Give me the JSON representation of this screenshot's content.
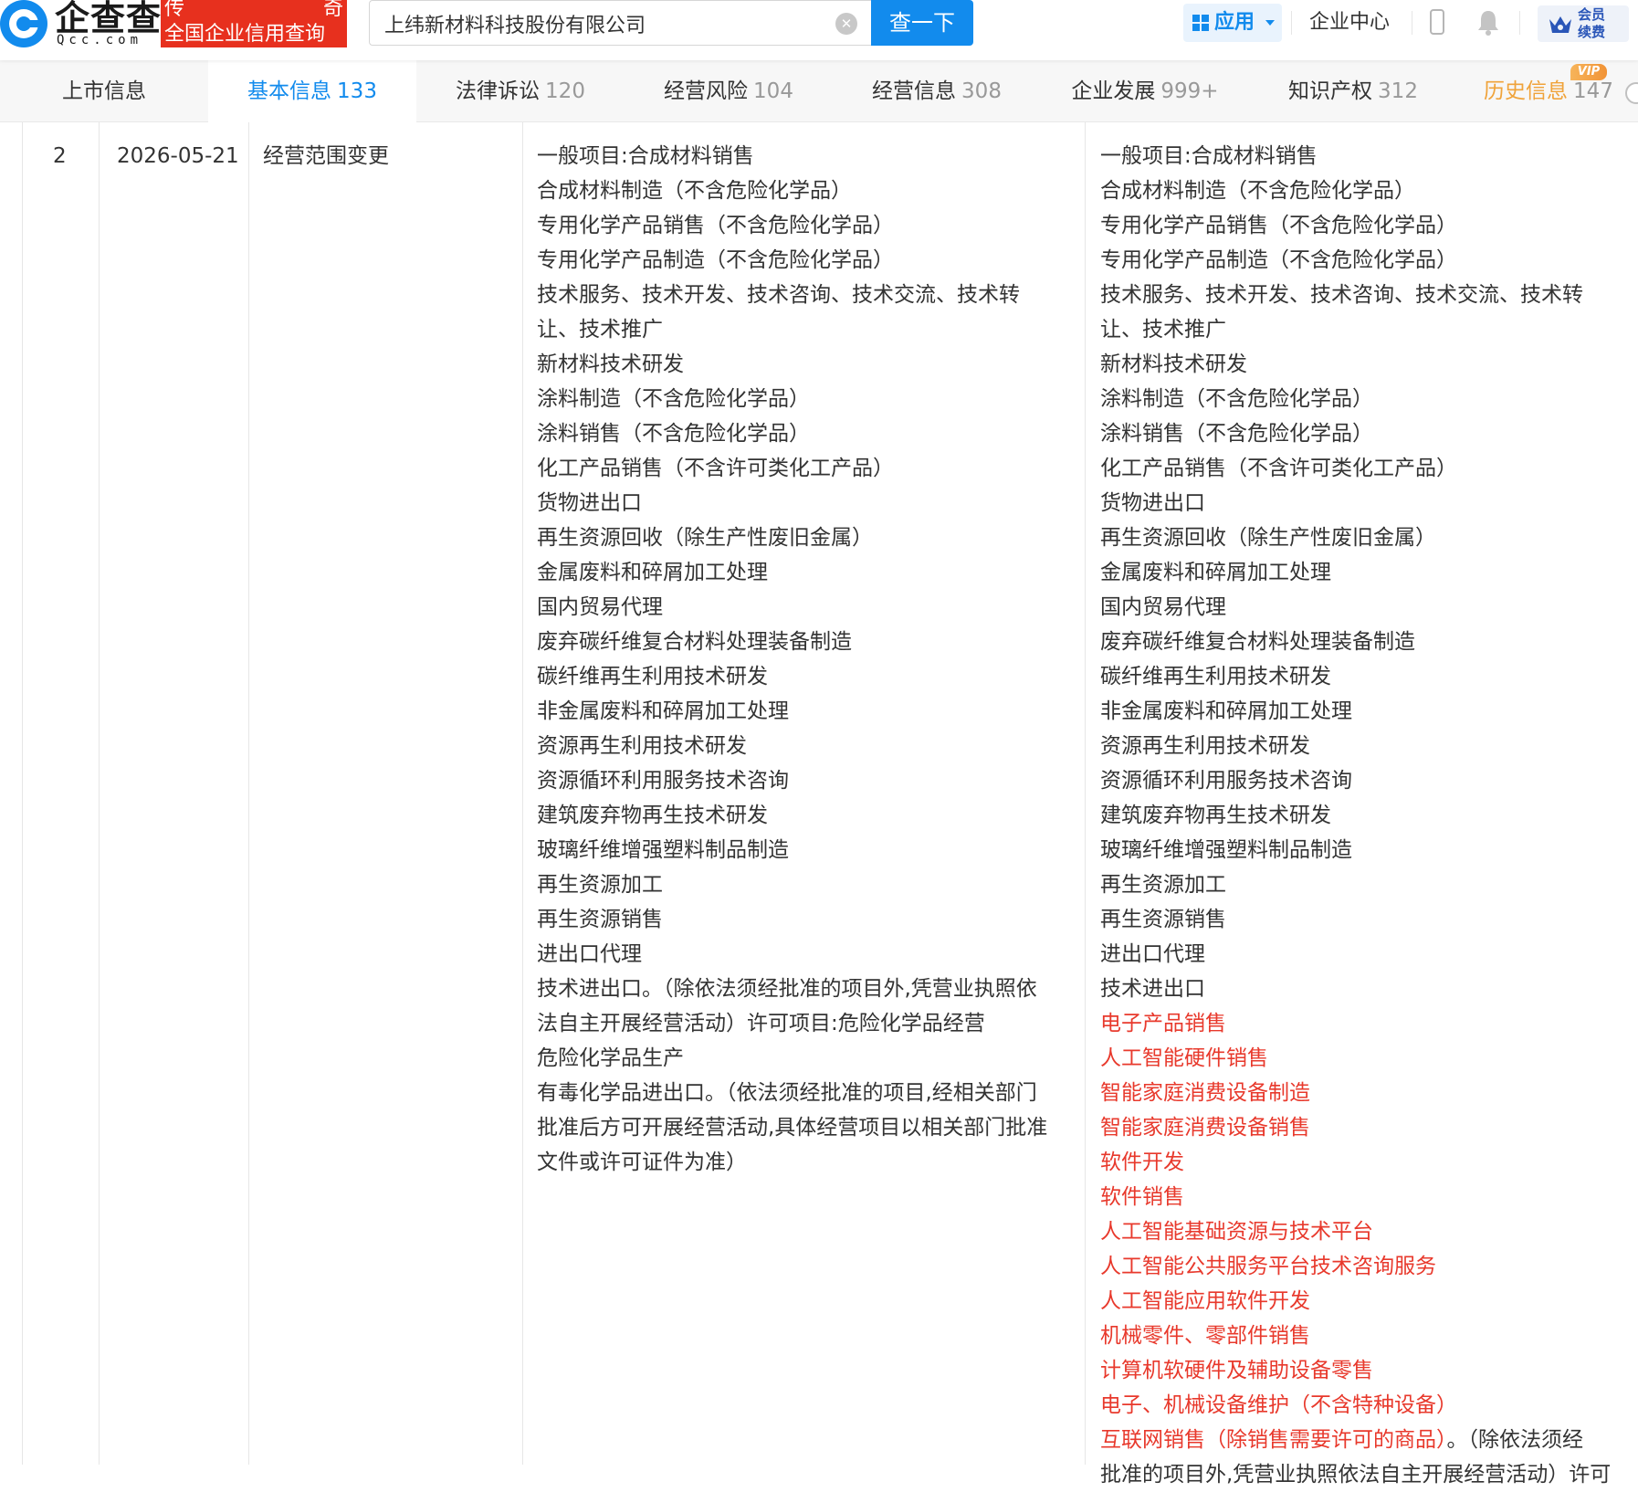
{
  "header": {
    "logo_cn": "企查查",
    "logo_en": "Qcc.com",
    "promo_top_left": "传",
    "promo_top_right": "奇",
    "promo_main": "全国企业信用查询",
    "search_value": "上纬新材料科技股份有限公司",
    "search_button": "查一下",
    "apps_label": "应用",
    "enterprise_center": "企业中心",
    "vip_line1": "会员",
    "vip_line2": "续费",
    "accent": "#128bed",
    "promo_color": "#e7301e"
  },
  "tabs": [
    {
      "label": "上市信息",
      "count": ""
    },
    {
      "label": "基本信息",
      "count": "133"
    },
    {
      "label": "法律诉讼",
      "count": "120"
    },
    {
      "label": "经营风险",
      "count": "104"
    },
    {
      "label": "经营信息",
      "count": "308"
    },
    {
      "label": "企业发展",
      "count": "999+"
    },
    {
      "label": "知识产权",
      "count": "312"
    },
    {
      "label": "历史信息",
      "count": "147"
    }
  ],
  "active_tab": "基本信息",
  "vip_badge": "VIP",
  "row": {
    "index": "2",
    "date": "2026-05-21",
    "item": "经营范围变更",
    "before": [
      "一般项目:合成材料销售",
      "合成材料制造（不含危险化学品）",
      "专用化学产品销售（不含危险化学品）",
      "专用化学产品制造（不含危险化学品）",
      "技术服务、技术开发、技术咨询、技术交流、技术转",
      "让、技术推广",
      "新材料技术研发",
      "涂料制造（不含危险化学品）",
      "涂料销售（不含危险化学品）",
      "化工产品销售（不含许可类化工产品）",
      "货物进出口",
      "再生资源回收（除生产性废旧金属）",
      "金属废料和碎屑加工处理",
      "国内贸易代理",
      "废弃碳纤维复合材料处理装备制造",
      "碳纤维再生利用技术研发",
      "非金属废料和碎屑加工处理",
      "资源再生利用技术研发",
      "资源循环利用服务技术咨询",
      "建筑废弃物再生技术研发",
      "玻璃纤维增强塑料制品制造",
      "再生资源加工",
      "再生资源销售",
      "进出口代理",
      "技术进出口。（除依法须经批准的项目外,凭营业执照依",
      "法自主开展经营活动）许可项目:危险化学品经营",
      "危险化学品生产",
      "有毒化学品进出口。（依法须经批准的项目,经相关部门",
      "批准后方可开展经营活动,具体经营项目以相关部门批准",
      "文件或许可证件为准）"
    ],
    "after_unchanged": [
      "一般项目:合成材料销售",
      "合成材料制造（不含危险化学品）",
      "专用化学产品销售（不含危险化学品）",
      "专用化学产品制造（不含危险化学品）",
      "技术服务、技术开发、技术咨询、技术交流、技术转",
      "让、技术推广",
      "新材料技术研发",
      "涂料制造（不含危险化学品）",
      "涂料销售（不含危险化学品）",
      "化工产品销售（不含许可类化工产品）",
      "货物进出口",
      "再生资源回收（除生产性废旧金属）",
      "金属废料和碎屑加工处理",
      "国内贸易代理",
      "废弃碳纤维复合材料处理装备制造",
      "碳纤维再生利用技术研发",
      "非金属废料和碎屑加工处理",
      "资源再生利用技术研发",
      "资源循环利用服务技术咨询",
      "建筑废弃物再生技术研发",
      "玻璃纤维增强塑料制品制造",
      "再生资源加工",
      "再生资源销售",
      "进出口代理",
      "技术进出口"
    ],
    "after_added": [
      "电子产品销售",
      "人工智能硬件销售",
      "智能家庭消费设备制造",
      "智能家庭消费设备销售",
      "软件开发",
      "软件销售",
      "人工智能基础资源与技术平台",
      "人工智能公共服务平台技术咨询服务",
      "人工智能应用软件开发",
      "机械零件、零部件销售",
      "计算机软硬件及辅助设备零售",
      "电子、机械设备维护（不含特种设备）",
      "互联网销售（除销售需要许可的商品）"
    ],
    "after_tail": "。（除依法须经",
    "after_cutoff": "批准的项目外,凭营业执照依法自主开展经营活动）许可",
    "added_color": "#e8392c"
  }
}
